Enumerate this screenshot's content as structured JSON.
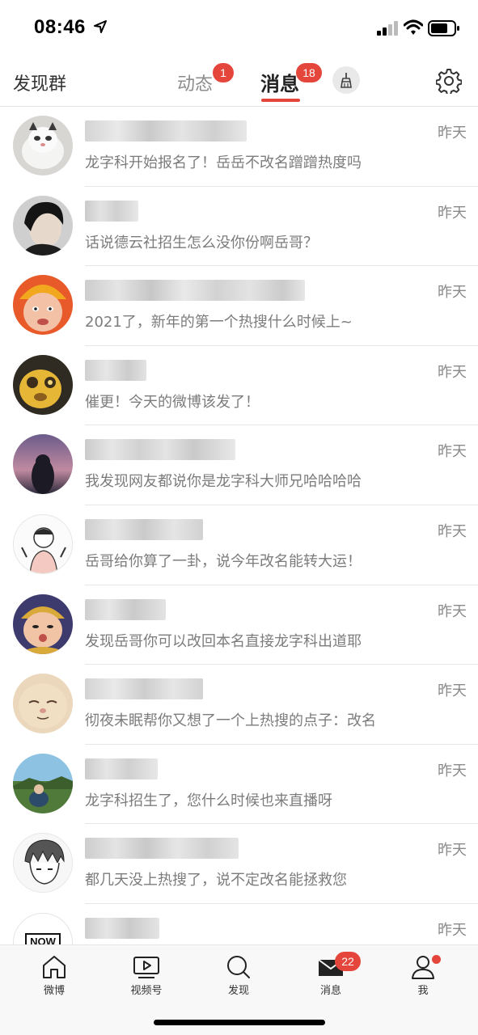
{
  "status_bar": {
    "time": "08:46"
  },
  "header": {
    "left_label": "发现群",
    "tabs": [
      {
        "label": "动态",
        "badge": "1"
      },
      {
        "label": "消息",
        "badge": "18"
      }
    ]
  },
  "messages": [
    {
      "preview": "龙字科开始报名了！岳岳不改名蹭蹭热度吗",
      "time": "昨天"
    },
    {
      "preview": "话说德云社招生怎么没你份啊岳哥？",
      "time": "昨天"
    },
    {
      "preview": "2021了，新年的第一个热搜什么时候上~",
      "time": "昨天"
    },
    {
      "preview": "催更！今天的微博该发了！",
      "time": "昨天"
    },
    {
      "preview": "我发现网友都说你是龙字科大师兄哈哈哈哈",
      "time": "昨天"
    },
    {
      "preview": "岳哥给你算了一卦，说今年改名能转大运！",
      "time": "昨天"
    },
    {
      "preview": "发现岳哥你可以改回本名直接龙字科出道耶",
      "time": "昨天"
    },
    {
      "preview": "彻夜未眠帮你又想了一个上热搜的点子：改名",
      "time": "昨天"
    },
    {
      "preview": "龙字科招生了，您什么时候也来直播呀",
      "time": "昨天"
    },
    {
      "preview": "都几天没上热搜了，说不定改名能拯救您",
      "time": "昨天"
    },
    {
      "preview": "",
      "time": "昨天",
      "avatar_text": "NOW"
    }
  ],
  "tabbar": {
    "items": [
      {
        "label": "微博",
        "icon": "home-icon"
      },
      {
        "label": "视频号",
        "icon": "video-icon"
      },
      {
        "label": "发现",
        "icon": "search-icon"
      },
      {
        "label": "消息",
        "icon": "mail-icon",
        "badge": "22"
      },
      {
        "label": "我",
        "icon": "profile-icon"
      }
    ]
  },
  "colors": {
    "accent": "#e5463c",
    "text_secondary": "#7c7c7c"
  }
}
